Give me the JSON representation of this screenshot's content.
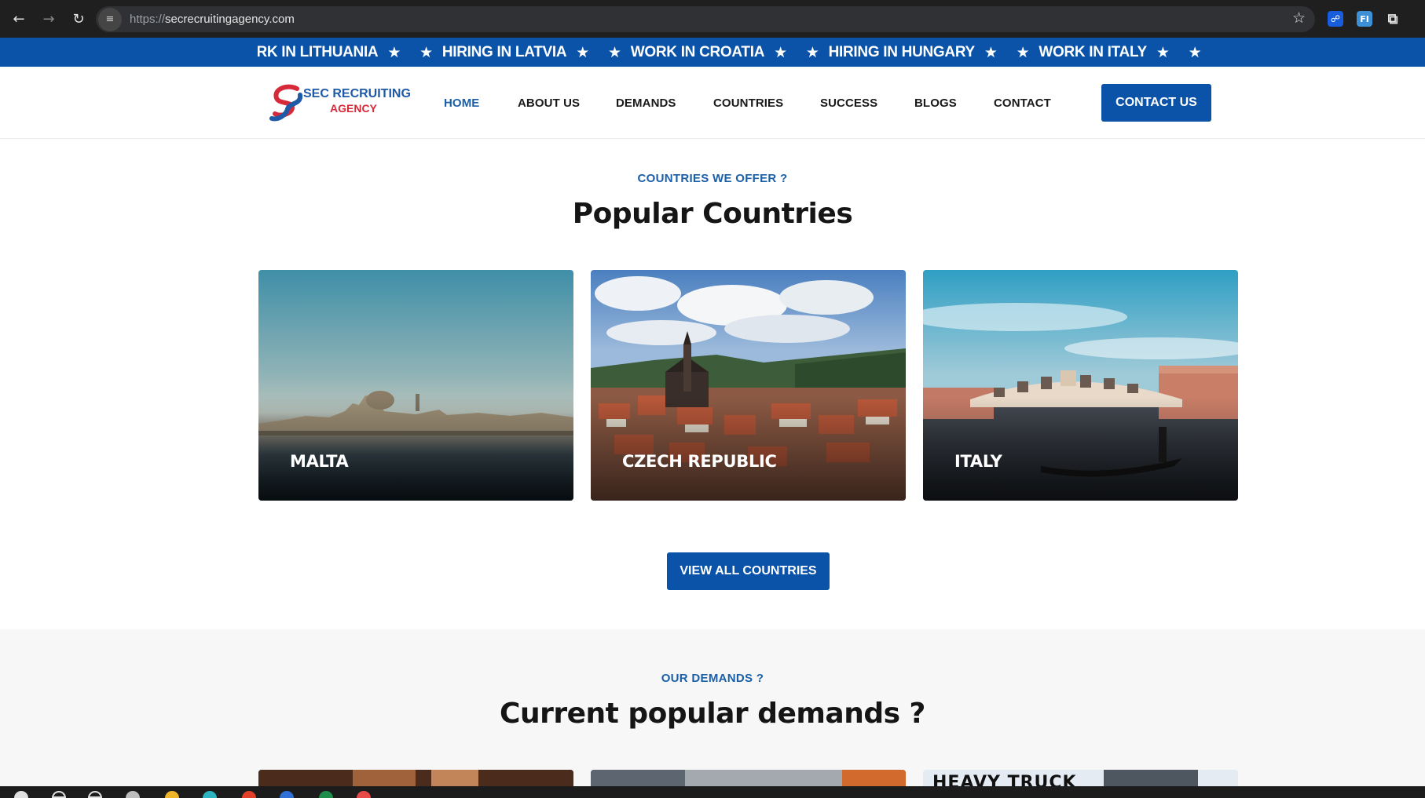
{
  "browser": {
    "back_icon": "arrow-left-icon",
    "forward_icon": "arrow-right-icon",
    "reload_icon": "reload-icon",
    "url_scheme": "https://",
    "url_host": "secrecruitingagency.com",
    "bookmark_icon": "star-outline-icon",
    "extensions": [
      "bitwarden-icon",
      "fi-extension-icon",
      "puzzle-icon"
    ],
    "ext_fi_label": "FI"
  },
  "ticker": {
    "items": [
      "ORK IN LITHUANIA",
      "HIRING IN LATVIA",
      "WORK IN CROATIA",
      "HIRING IN HUNGARY",
      "WORK IN ITALY"
    ],
    "color": "#0a53a8"
  },
  "header": {
    "logo_line1": "SEC RECRUITING",
    "logo_line2": "AGENCY",
    "nav": {
      "home": "HOME",
      "about": "ABOUT US",
      "demands": "DEMANDS",
      "countries": "COUNTRIES",
      "success": "SUCCESS",
      "blogs": "BLOGS",
      "contact": "CONTACT"
    },
    "active_nav": "HOME",
    "cta": "CONTACT US"
  },
  "countries_section": {
    "eyebrow": "COUNTRIES WE OFFER ?",
    "title": "Popular Countries",
    "cards": [
      {
        "label": "MALTA"
      },
      {
        "label": "CZECH REPUBLIC"
      },
      {
        "label": "ITALY"
      }
    ],
    "view_all": "VIEW ALL COUNTRIES"
  },
  "demands_section": {
    "eyebrow": "OUR DEMANDS ?",
    "title": "Current popular demands ?",
    "third_card_text": "HEAVY TRUCK"
  },
  "colors": {
    "brand_blue": "#0a53a8",
    "brand_red": "#d62a3a",
    "link_blue": "#1a5fa8"
  }
}
